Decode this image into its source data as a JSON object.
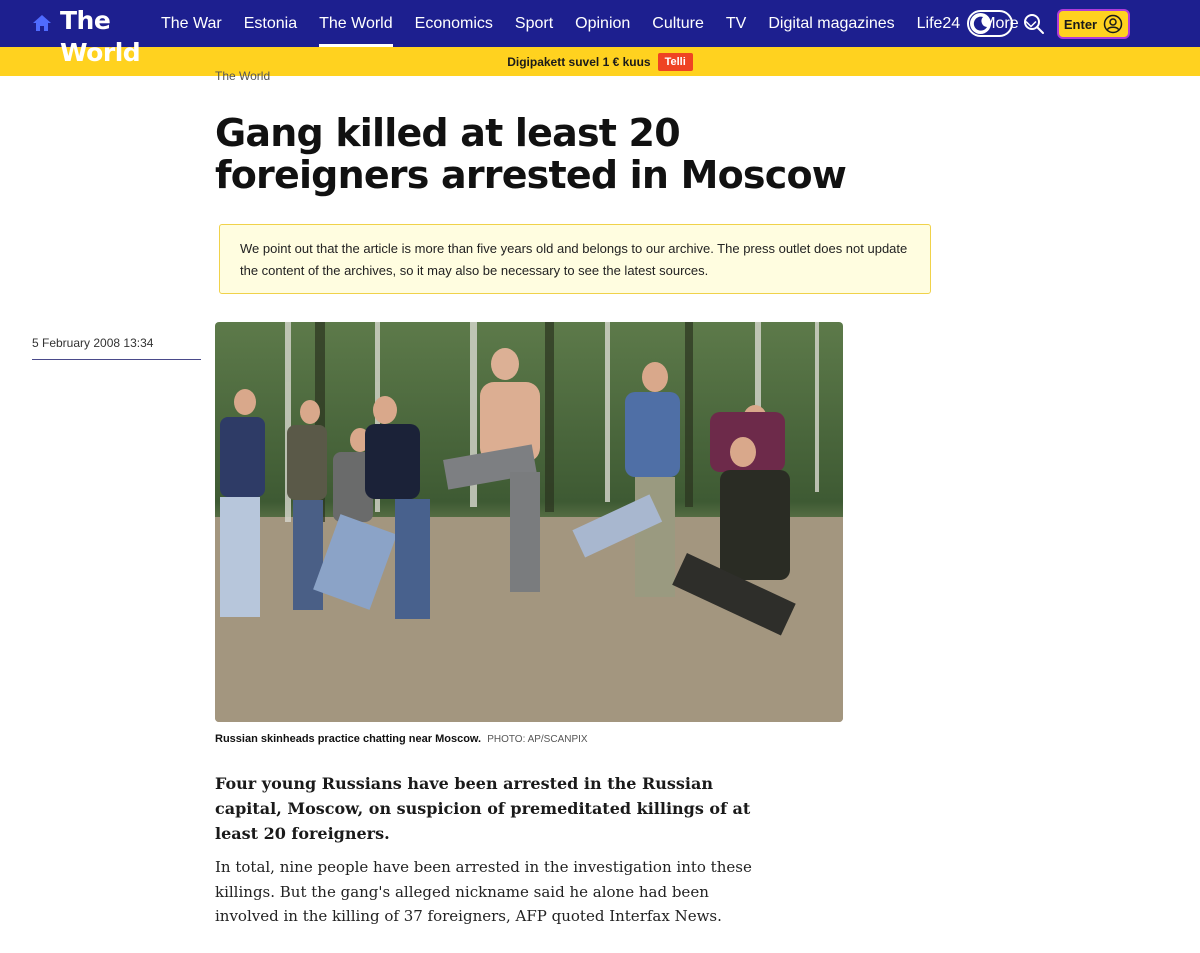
{
  "header": {
    "logo_line1": "The",
    "logo_line2": "World",
    "home_icon": "home-icon",
    "nav": [
      "The War",
      "Estonia",
      "The World",
      "Economics",
      "Sport",
      "Opinion",
      "Culture",
      "TV",
      "Digital magazines",
      "Life24"
    ],
    "active_nav": "The World",
    "more_label": "More",
    "theme_icon": "moon-icon",
    "search_icon": "search-icon",
    "enter_label": "Enter",
    "enter_icon": "user-icon"
  },
  "promo": {
    "text": "Digipakett suvel 1 € kuus",
    "button": "Telli"
  },
  "article": {
    "section": "The World",
    "headline": "Gang killed at least 20 foreigners arrested in Moscow",
    "archive_notice": "We point out that the article is more than five years old and belongs to our archive. The press outlet does not update the content of the archives, so it may also be necessary to see the latest sources.",
    "date": "5 February 2008 13:34",
    "caption": "Russian skinheads practice chatting near Moscow.",
    "photo_credit": "PHOTO: AP/SCANPIX",
    "lead": "Four young Russians have been arrested in the Russian capital, Moscow, on suspicion of premeditated killings of at least 20 foreigners.",
    "body": "In total, nine people have been arrested in the investigation into these killings. But the gang's alleged nickname said he alone had been involved in the killing of 37 foreigners, AFP quoted Interfax News."
  },
  "colors": {
    "nav_bg": "#1d1f8f",
    "accent_yellow": "#ffd21f",
    "promo_button": "#ef4323",
    "notice_bg": "#fffde0"
  }
}
